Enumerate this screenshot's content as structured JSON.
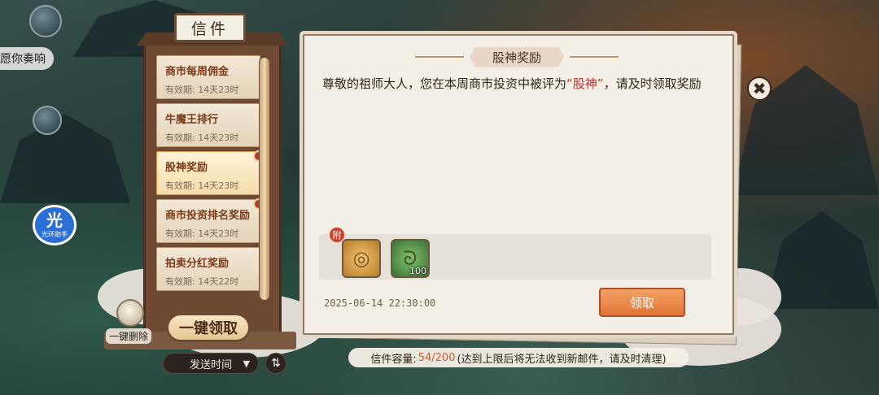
{
  "hud": {
    "partial_label": "愿你奏响"
  },
  "helper": {
    "big": "光",
    "small": "光环助手"
  },
  "mailbox": {
    "title": "信件",
    "items": [
      {
        "title": "商市每周佣金",
        "expiry": "有效期: 14天23时"
      },
      {
        "title": "牛魔王排行",
        "expiry": "有效期: 14天23时"
      },
      {
        "title": "股神奖励",
        "expiry": "有效期: 14天23时",
        "selected": true
      },
      {
        "title": "商市投资排名奖励",
        "expiry": "有效期: 14天23时"
      },
      {
        "title": "拍卖分红奖励",
        "expiry": "有效期: 14天22时"
      }
    ],
    "delete_all_label": "一键删除",
    "claim_all_label": "一键领取",
    "sort_label": "发送时间",
    "sort_arrow": "▼",
    "sort_toggle_icon": "⇅"
  },
  "letter": {
    "title": "股神奖励",
    "body_before": "尊敬的祖师大人，您在本周商市投资中被评为",
    "body_highlight": "“股神”",
    "body_after": "，请及时领取奖励",
    "attach_tag": "附",
    "attachments": [
      {
        "icon": "gold-bracelet-icon",
        "qty": ""
      },
      {
        "icon": "jade-pendant-icon",
        "qty": "100"
      }
    ],
    "date": "2025-06-14 22:30:00",
    "claim_label": "领取",
    "close_icon": "✖"
  },
  "capacity": {
    "label": "信件容量:",
    "value": "54/200",
    "note": "(达到上限后将无法收到新邮件，请及时清理)"
  },
  "colors": {
    "highlight": "#c0312a",
    "claim_button": "#e07434",
    "capacity_value": "#d1592a"
  }
}
